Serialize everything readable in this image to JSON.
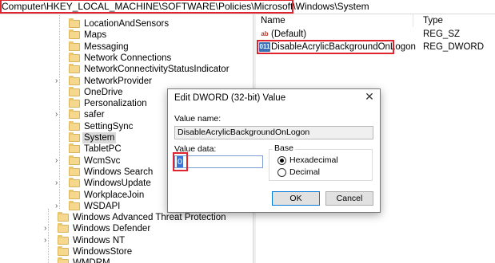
{
  "address_bar": {
    "path": "Computer\\HKEY_LOCAL_MACHINE\\SOFTWARE\\Policies\\Microsoft\\Windows\\System"
  },
  "tree": {
    "items": [
      {
        "label": "LocationAndSensors",
        "has_children": false
      },
      {
        "label": "Maps",
        "has_children": false
      },
      {
        "label": "Messaging",
        "has_children": false
      },
      {
        "label": "Network Connections",
        "has_children": false
      },
      {
        "label": "NetworkConnectivityStatusIndicator",
        "has_children": false
      },
      {
        "label": "NetworkProvider",
        "has_children": true
      },
      {
        "label": "OneDrive",
        "has_children": false
      },
      {
        "label": "Personalization",
        "has_children": false
      },
      {
        "label": "safer",
        "has_children": true
      },
      {
        "label": "SettingSync",
        "has_children": false
      },
      {
        "label": "System",
        "has_children": false,
        "selected": true
      },
      {
        "label": "TabletPC",
        "has_children": false
      },
      {
        "label": "WcmSvc",
        "has_children": true
      },
      {
        "label": "Windows Search",
        "has_children": false
      },
      {
        "label": "WindowsUpdate",
        "has_children": true
      },
      {
        "label": "WorkplaceJoin",
        "has_children": false
      },
      {
        "label": "WSDAPI",
        "has_children": true
      },
      {
        "label": "Windows Advanced Threat Protection",
        "has_children": false
      },
      {
        "label": "Windows Defender",
        "has_children": true
      },
      {
        "label": "Windows NT",
        "has_children": true
      },
      {
        "label": "WindowsStore",
        "has_children": false
      },
      {
        "label": "WMDRM",
        "has_children": false
      }
    ]
  },
  "values_pane": {
    "header_name": "Name",
    "header_type": "Type",
    "rows": [
      {
        "icon": "string-value-icon",
        "icon_text": "ab",
        "name": "(Default)",
        "type": "REG_SZ"
      },
      {
        "icon": "dword-value-icon",
        "icon_text": "011",
        "name": "DisableAcrylicBackgroundOnLogon",
        "type": "REG_DWORD"
      }
    ]
  },
  "dialog": {
    "title": "Edit DWORD (32-bit) Value",
    "value_name_label": "Value name:",
    "value_name": "DisableAcrylicBackgroundOnLogon",
    "value_data_label": "Value data:",
    "value_data": "0",
    "base_label": "Base",
    "base_options": [
      {
        "label": "Hexadecimal",
        "checked": true
      },
      {
        "label": "Decimal",
        "checked": false
      }
    ],
    "ok_label": "OK",
    "cancel_label": "Cancel",
    "close_glyph": "✕"
  },
  "colors": {
    "highlight_red": "#e0232c",
    "selection_gray": "#d9d9d9",
    "accent_blue": "#0078d7"
  }
}
